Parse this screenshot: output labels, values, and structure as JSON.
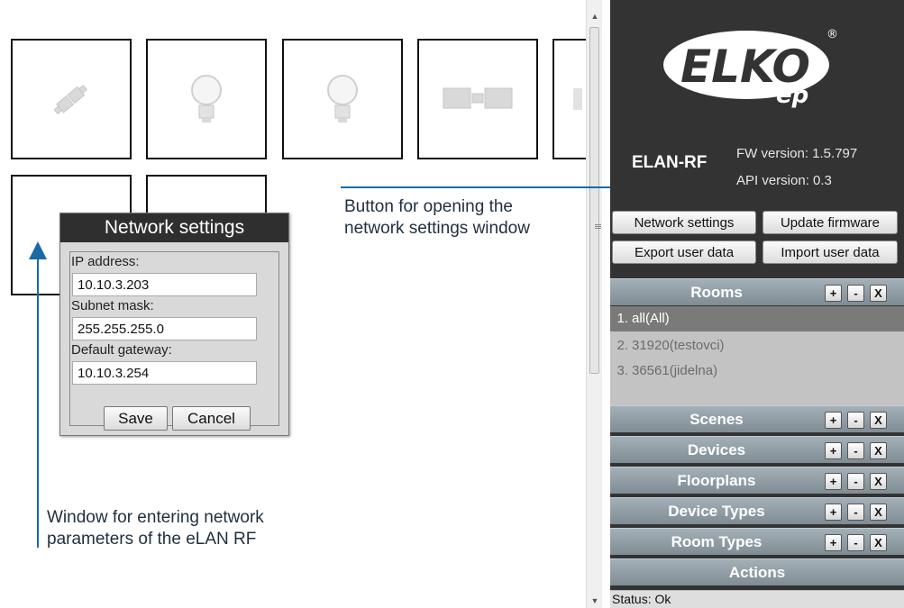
{
  "tiles": [
    {
      "icon": "cable-connector-icon"
    },
    {
      "icon": "light-bulb-icon"
    },
    {
      "icon": "light-bulb-icon"
    },
    {
      "icon": "blinds-icon"
    },
    {
      "icon": "partial-tile-icon"
    },
    {
      "icon": "unknown-icon"
    },
    {
      "icon": "unknown-icon"
    }
  ],
  "dialog": {
    "title": "Network settings",
    "ip_label": "IP address:",
    "ip_value": "10.10.3.203",
    "mask_label": "Subnet mask:",
    "mask_value": "255.255.255.0",
    "gateway_label": "Default gateway:",
    "gateway_value": "10.10.3.254",
    "save_label": "Save",
    "cancel_label": "Cancel"
  },
  "annotations": {
    "button_note": "Button for opening the network settings window",
    "window_note": "Window for entering network parameters of the eLAN RF"
  },
  "panel": {
    "logo_text": "ELKO",
    "logo_sub": "ep",
    "logo_mark": "®",
    "device_name": "ELAN-RF",
    "fw_version": "FW version: 1.5.797",
    "api_version": "API version: 0.3",
    "buttons": {
      "network_settings": "Network settings",
      "update_firmware": "Update firmware",
      "export_user_data": "Export user data",
      "import_user_data": "Import user data"
    },
    "sections": [
      {
        "label": "Rooms"
      },
      {
        "label": "Scenes"
      },
      {
        "label": "Devices"
      },
      {
        "label": "Floorplans"
      },
      {
        "label": "Device Types"
      },
      {
        "label": "Room Types"
      },
      {
        "label": "Actions"
      }
    ],
    "section_buttons": {
      "add": "+",
      "remove": "-",
      "close": "X"
    },
    "rooms": [
      {
        "num": "1.",
        "name": "all(All)"
      },
      {
        "num": "2.",
        "name": "31920(testovci)"
      },
      {
        "num": "3.",
        "name": "36561(jidelna)"
      }
    ],
    "status": "Status: Ok"
  },
  "colors": {
    "panel_bg": "#333333",
    "section_header": "#8e9aa2",
    "annotation_blue": "#1a6aa8",
    "selected_row": "#7a7a7a"
  }
}
